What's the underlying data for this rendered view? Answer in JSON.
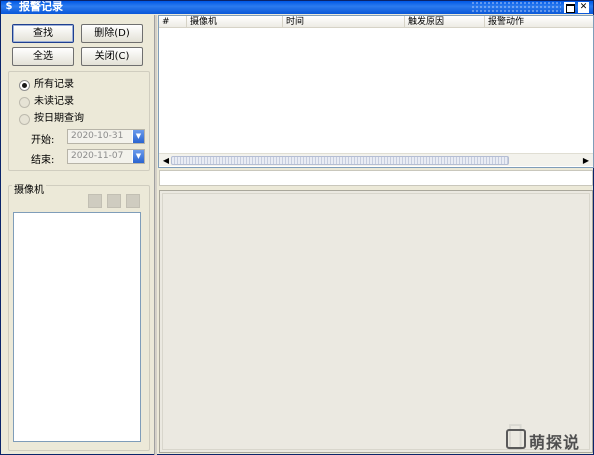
{
  "window": {
    "title": "报警记录"
  },
  "toolbar": {
    "search_label": "查找",
    "delete_label": "删除(D)",
    "select_all_label": "全选",
    "close_label": "关闭(C)"
  },
  "filter": {
    "options": [
      {
        "label": "所有记录",
        "checked": true,
        "disabled": false
      },
      {
        "label": "未读记录",
        "checked": false,
        "disabled": true
      },
      {
        "label": "按日期查询",
        "checked": false,
        "disabled": true
      }
    ],
    "start_label": "开始:",
    "start_date": "2020-10-31",
    "end_label": "结束:",
    "end_date": "2020-11-07"
  },
  "camera_group": {
    "label": "摄像机"
  },
  "table": {
    "columns": [
      "#",
      "摄像机",
      "时间",
      "触发原因",
      "报警动作"
    ],
    "rows": []
  },
  "watermark": {
    "text": "萌探说"
  },
  "colors": {
    "titlebar": "#0058E6",
    "face": "#ECE9D8",
    "field_border": "#7F9DB9"
  }
}
